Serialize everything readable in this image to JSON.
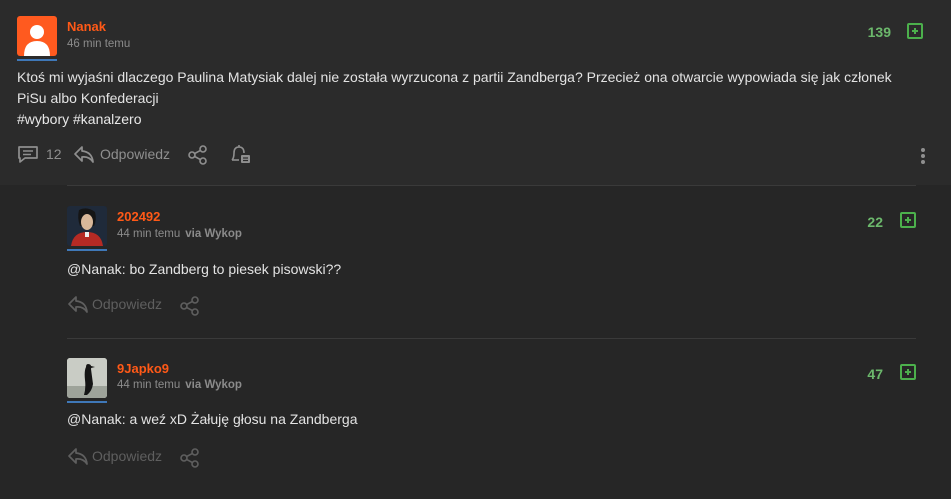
{
  "post": {
    "author": "Nanak",
    "time": "46 min temu",
    "score": "139",
    "text": "Ktoś mi wyjaśni dlaczego Paulina Matysiak dalej nie została wyrzucona z partii Zandberga? Przecież ona otwarcie wypowiada się jak członek PiSu albo Konfederacji",
    "tags": "#wybory #kanalzero",
    "comment_count": "12",
    "reply_label": "Odpowiedz"
  },
  "comments": [
    {
      "author": "202492",
      "time": "44 min temu",
      "via": "via Wykop",
      "score": "22",
      "mention": "@Nanak",
      "text": ": bo Zandberg to piesek pisowski??",
      "reply_label": "Odpowiedz"
    },
    {
      "author": "9Japko9",
      "time": "44 min temu",
      "via": "via Wykop",
      "score": "47",
      "mention": "@Nanak",
      "text": ": a weź xD Żałuję głosu na Zandberga",
      "reply_label": "Odpowiedz"
    }
  ],
  "colors": {
    "username": "#ff5917",
    "score": "#6cb86c",
    "background": "#262626"
  }
}
